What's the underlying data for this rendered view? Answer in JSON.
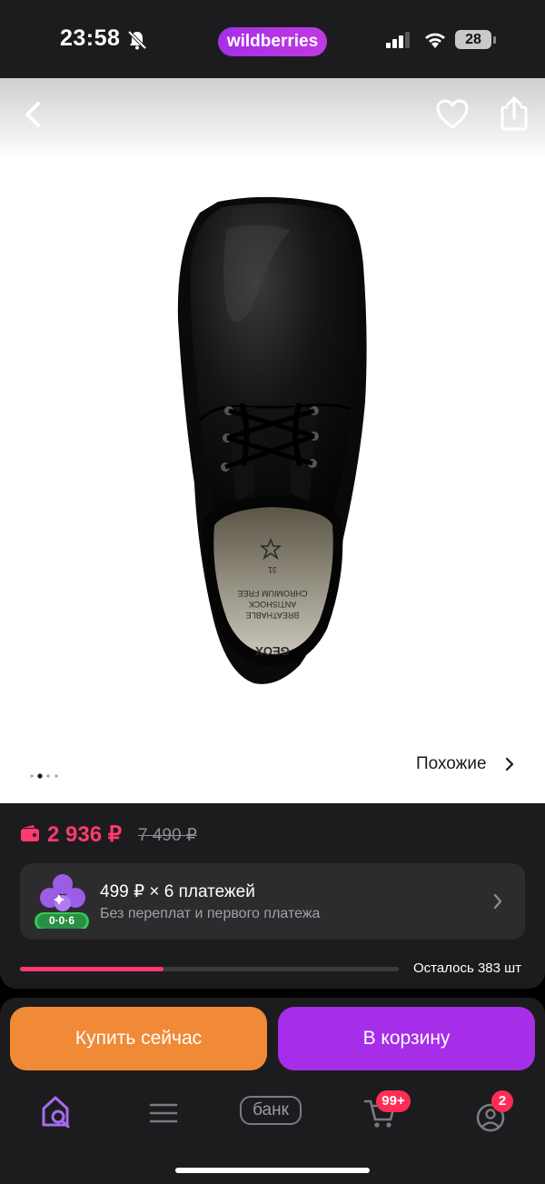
{
  "status_bar": {
    "time": "23:58",
    "app_badge": "wildberries",
    "battery": "28"
  },
  "product": {
    "similar_label": "Похожие",
    "gallery": {
      "count": 4,
      "active_index": 1
    },
    "insole_text": [
      "GEOX",
      "BREATHABLE",
      "ANTISHOCK",
      "CHROMIUM FREE",
      "31"
    ]
  },
  "pricing": {
    "price": "2 936 ₽",
    "old_price": "7 490 ₽",
    "installment_title": "499 ₽ × 6 платежей",
    "installment_subtitle": "Без переплат и первого платежа",
    "installment_badge": "0·0·6",
    "stock_label": "Осталось 383 шт",
    "stock_fraction": 0.38
  },
  "actions": {
    "buy_now": "Купить сейчас",
    "add_to_cart": "В корзину"
  },
  "tabbar": {
    "bank_label": "банк",
    "cart_badge": "99+",
    "profile_badge": "2"
  },
  "colors": {
    "accent_purple": "#a62ee9",
    "buy_orange": "#f08a36",
    "price_pink": "#ff3a6e"
  }
}
